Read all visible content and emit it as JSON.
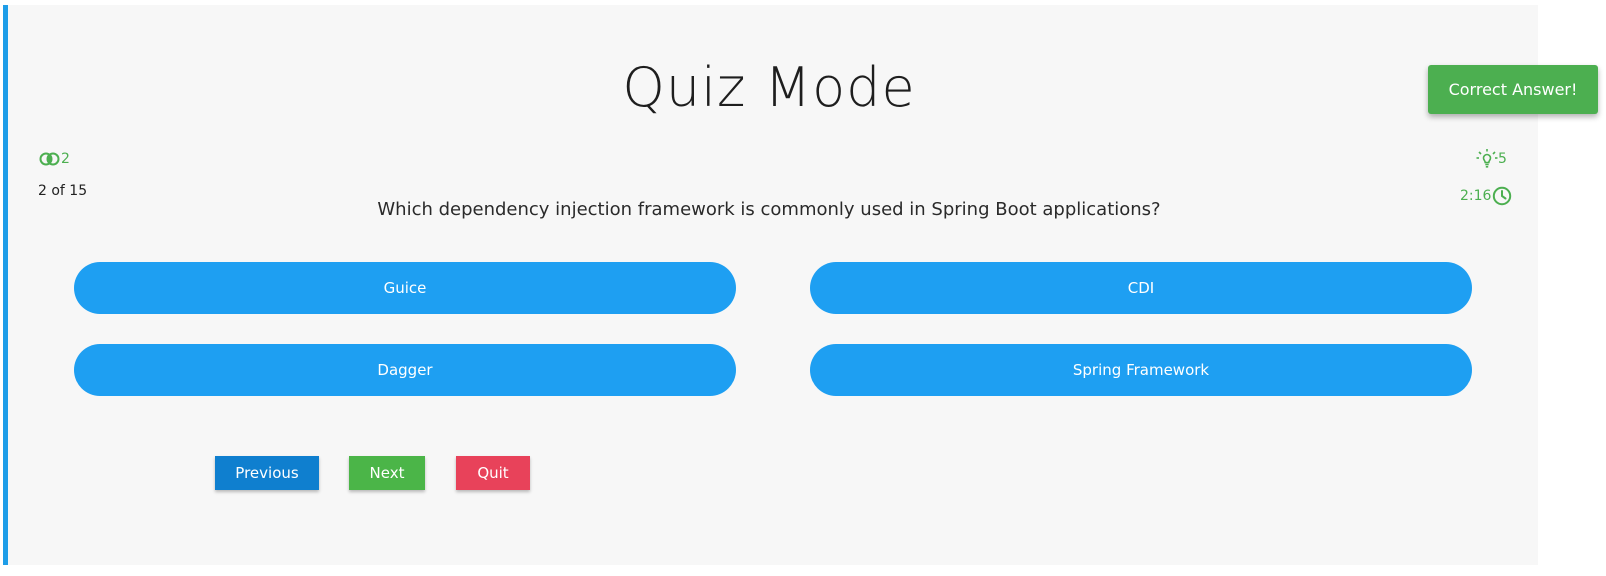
{
  "quiz": {
    "title": "Quiz Mode",
    "lifelines_count": "2",
    "progress": "2 of 15",
    "hints_count": "5",
    "timer": "2:16",
    "question": "Which dependency injection framework is commonly used in Spring Boot applications?",
    "options": [
      "Guice",
      "CDI",
      "Dagger",
      "Spring Framework"
    ]
  },
  "controls": {
    "previous_label": "Previous",
    "next_label": "Next",
    "quit_label": "Quit"
  },
  "toast": {
    "message": "Correct Answer!"
  },
  "icons": {
    "lifelines": "lifeline-circles-icon",
    "hints": "lightbulb-icon",
    "timer": "clock-icon"
  },
  "colors": {
    "accent_blue": "#1e9ff2",
    "previous_blue": "#0f7fcf",
    "success_green": "#4caf50",
    "next_green": "#4bb548",
    "quit_red": "#e8425a",
    "panel_bg": "#f7f7f7"
  }
}
